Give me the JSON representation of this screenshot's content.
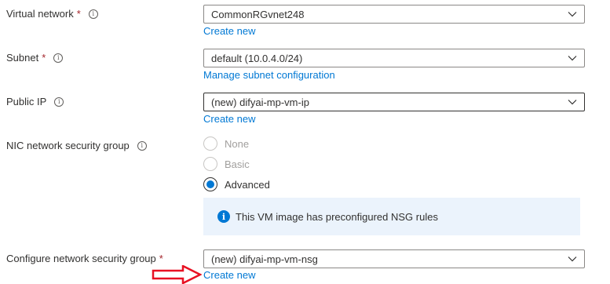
{
  "fields": {
    "virtual_network": {
      "label": "Virtual network",
      "required": "*",
      "value": "CommonRGvnet248",
      "link": "Create new"
    },
    "subnet": {
      "label": "Subnet",
      "required": "*",
      "value": "default (10.0.4.0/24)",
      "link": "Manage subnet configuration"
    },
    "public_ip": {
      "label": "Public IP",
      "value": "(new) difyai-mp-vm-ip",
      "link": "Create new"
    },
    "nic_nsg": {
      "label": "NIC network security group",
      "options": [
        {
          "label": "None",
          "state": "disabled"
        },
        {
          "label": "Basic",
          "state": "disabled"
        },
        {
          "label": "Advanced",
          "state": "selected"
        }
      ],
      "info_message": "This VM image has preconfigured NSG rules"
    },
    "configure_nsg": {
      "label": "Configure network security group",
      "required": "*",
      "value": "(new) difyai-mp-vm-nsg",
      "link": "Create new"
    }
  },
  "icons": {
    "info": "info-circle-icon",
    "chevron": "chevron-down-icon",
    "annotation": "red-arrow-icon"
  },
  "colors": {
    "link": "#0078d4",
    "required": "#a4262c",
    "info_bg": "#ebf3fc",
    "annotation_arrow": "#e81123"
  }
}
